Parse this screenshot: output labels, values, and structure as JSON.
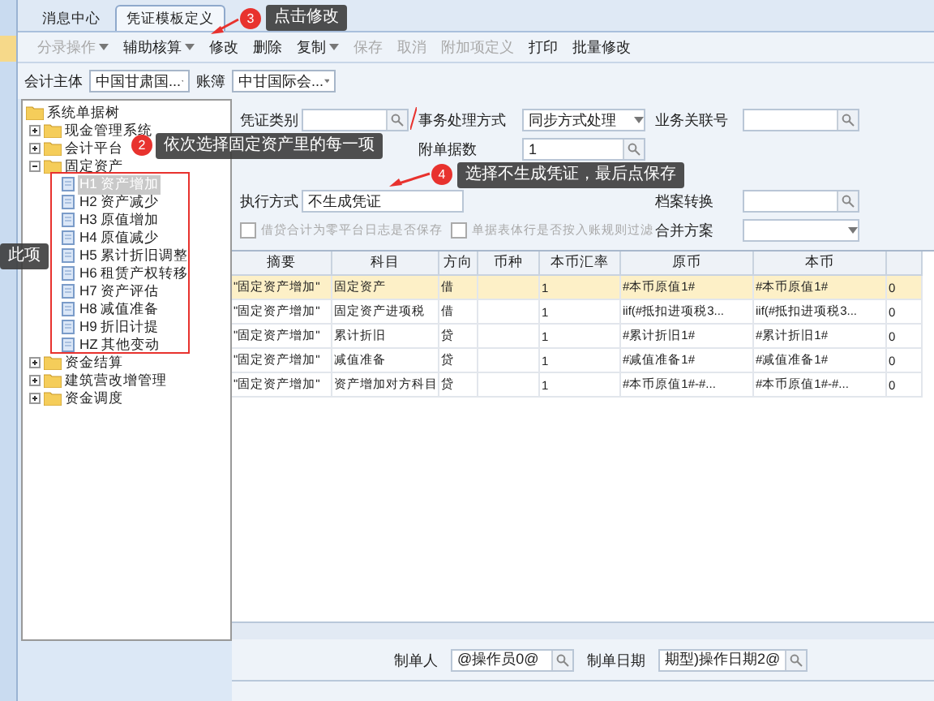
{
  "tabs": [
    {
      "label": "消息中心",
      "selected": false
    },
    {
      "label": "凭证模板定义",
      "selected": true
    }
  ],
  "toolbar": [
    {
      "label": "分录操作",
      "dropdown": true,
      "disabled": true
    },
    {
      "label": "辅助核算",
      "dropdown": true,
      "disabled": false
    },
    {
      "label": "修改",
      "dropdown": false,
      "disabled": false
    },
    {
      "label": "删除",
      "dropdown": false,
      "disabled": false
    },
    {
      "label": "复制",
      "dropdown": true,
      "disabled": false
    },
    {
      "label": "保存",
      "dropdown": false,
      "disabled": true
    },
    {
      "label": "取消",
      "dropdown": false,
      "disabled": true
    },
    {
      "label": "附加项定义",
      "dropdown": false,
      "disabled": true
    },
    {
      "label": "打印",
      "dropdown": false,
      "disabled": false
    },
    {
      "label": "批量修改",
      "dropdown": false,
      "disabled": false
    }
  ],
  "header": {
    "entity_label": "会计主体",
    "entity_value": "中国甘肃国...",
    "book_label": "账簿",
    "book_value": "中甘国际会..."
  },
  "tree": {
    "label": "系统单据树",
    "children": [
      {
        "label": "现金管理系统",
        "expanded": false
      },
      {
        "label": "会计平台",
        "expanded": false
      },
      {
        "label": "固定资产",
        "expanded": true,
        "children": [
          {
            "label": "H1 资产增加",
            "selected": true
          },
          {
            "label": "H2 资产减少",
            "selected": false
          },
          {
            "label": "H3 原值增加",
            "selected": false
          },
          {
            "label": "H4 原值减少",
            "selected": false
          },
          {
            "label": "H5 累计折旧调整",
            "selected": false
          },
          {
            "label": "H6 租赁产权转移",
            "selected": false
          },
          {
            "label": "H7 资产评估",
            "selected": false
          },
          {
            "label": "H8 减值准备",
            "selected": false
          },
          {
            "label": "H9 折旧计提",
            "selected": false
          },
          {
            "label": "HZ 其他变动",
            "selected": false
          }
        ]
      },
      {
        "label": "资金结算",
        "expanded": false
      },
      {
        "label": "建筑营改增管理",
        "expanded": false
      },
      {
        "label": "资金调度",
        "expanded": false
      }
    ]
  },
  "form": {
    "voucher_type_label": "凭证类别",
    "process_label": "事务处理方式",
    "process_value": "同步方式处理",
    "relation_label": "业务关联号",
    "attach_label": "附单据数",
    "attach_value": "1",
    "exec_label": "执行方式",
    "exec_value": "不生成凭证",
    "archive_label": "档案转换",
    "merge_label": "合并方案",
    "checkboxes": [
      {
        "label": "借贷合计为零平台日志是否保存",
        "checked": false,
        "disabled": true
      },
      {
        "label": "单据表体行是否按入账规则过滤",
        "checked": false,
        "disabled": true
      }
    ]
  },
  "table": {
    "columns": [
      "摘要",
      "科目",
      "方向",
      "币种",
      "本币汇率",
      "原币",
      "本币"
    ],
    "rows": [
      {
        "selected": true,
        "cells": [
          "\"固定资产增加\"",
          "固定资产",
          "借",
          "",
          "1",
          "#本币原值1#",
          "#本币原值1#",
          "0"
        ]
      },
      {
        "selected": false,
        "cells": [
          "\"固定资产增加\"",
          "固定资产进项税",
          "借",
          "",
          "1",
          "iif(#抵扣进项税3...",
          "iif(#抵扣进项税3...",
          "0"
        ]
      },
      {
        "selected": false,
        "cells": [
          "\"固定资产增加\"",
          "累计折旧",
          "贷",
          "",
          "1",
          "#累计折旧1#",
          "#累计折旧1#",
          "0"
        ]
      },
      {
        "selected": false,
        "cells": [
          "\"固定资产增加\"",
          "减值准备",
          "贷",
          "",
          "1",
          "#减值准备1#",
          "#减值准备1#",
          "0"
        ]
      },
      {
        "selected": false,
        "cells": [
          "\"固定资产增加\"",
          "资产增加对方科目",
          "贷",
          "",
          "1",
          "#本币原值1#-#...",
          "#本币原值1#-#...",
          "0"
        ]
      }
    ]
  },
  "footer": {
    "maker_label": "制单人",
    "maker_value": "@操作员0@",
    "date_label": "制单日期",
    "date_value": "期型)操作日期2@"
  },
  "annotations": [
    {
      "number": "3",
      "text": "点击修改"
    },
    {
      "number": "2",
      "text": "依次选择固定资产里的每一项"
    },
    {
      "number": "4",
      "text": "选择不生成凭证，最后点保存"
    },
    {
      "text": "此项"
    }
  ]
}
